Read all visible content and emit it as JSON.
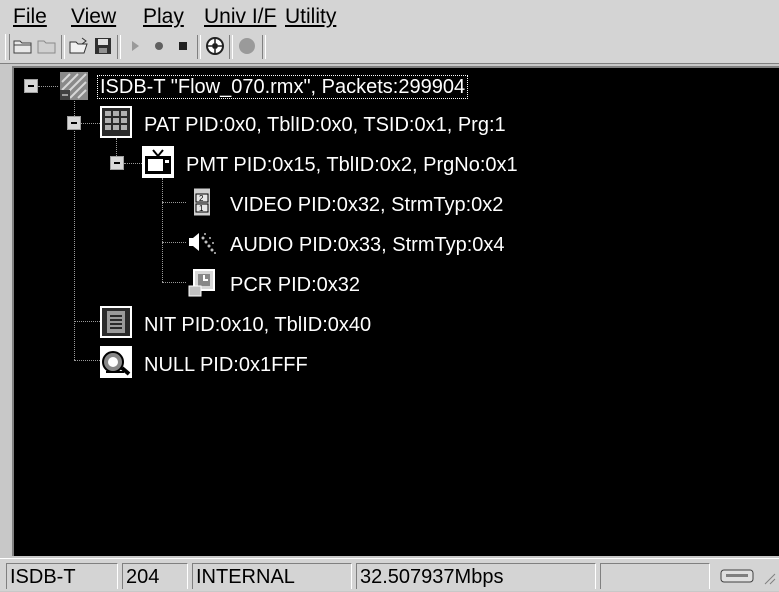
{
  "menu": {
    "file_label": "File",
    "view_label": "View",
    "play_label": "Play",
    "univif_label": "Univ I/F",
    "utility_label": "Utility"
  },
  "toolbar": {
    "icons": [
      "open-folder-icon",
      "folder-icon",
      "open-file-icon",
      "save-icon",
      "play-icon",
      "record-icon",
      "stop-icon",
      "settings-dial-icon",
      "status-light-icon"
    ]
  },
  "tree": {
    "root_label": "ISDB-T \"Flow_070.rmx\", Packets:299904",
    "pat_label": "PAT PID:0x0, TblID:0x0, TSID:0x1, Prg:1",
    "pmt_label": "PMT PID:0x15, TblID:0x2, PrgNo:0x1",
    "video_label": "VIDEO PID:0x32, StrmTyp:0x2",
    "audio_label": "AUDIO PID:0x33, StrmTyp:0x4",
    "pcr_label": "PCR PID:0x32",
    "nit_label": "NIT PID:0x10, TblID:0x40",
    "null_label": "NULL PID:0x1FFF"
  },
  "status": {
    "standard": "ISDB-T",
    "packet_size": "204",
    "clock": "INTERNAL",
    "rate": "32.507937Mbps",
    "extra": ""
  },
  "colors": {
    "tree_background": "#000000",
    "tree_text": "#ffffff",
    "chrome": "#d4d4d4"
  }
}
